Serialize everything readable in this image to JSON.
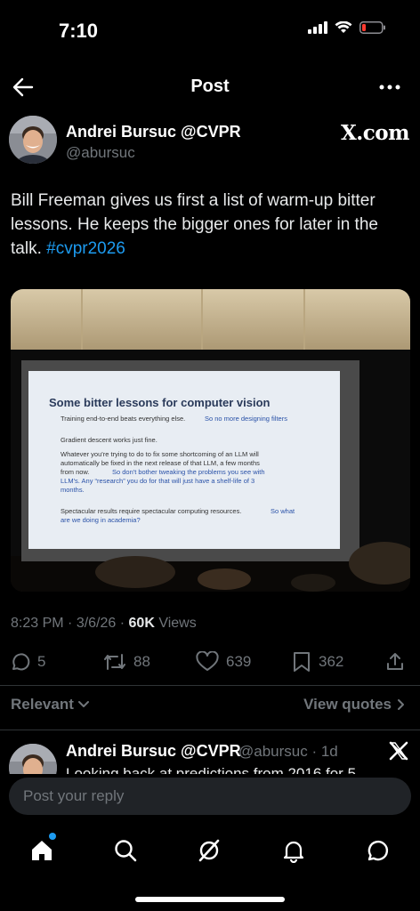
{
  "status": {
    "time": "7:10"
  },
  "nav": {
    "title": "Post"
  },
  "author": {
    "name": "Andrei Bursuc @CVPR",
    "handle": "@abursuc",
    "source_logo": "X.com"
  },
  "tweet": {
    "text": "Bill Freeman gives us first a list of warm-up bitter lessons. He keeps the bigger ones for later in the talk. ",
    "hashtag": "#cvpr2026"
  },
  "slide": {
    "title": "Some bitter lessons for computer vision",
    "p1_black": "Training end-to-end beats everything else.",
    "p1_blue": "So no more designing filters",
    "p2_black": "Gradient descent works just fine.",
    "p3_black_1": "Whatever you're trying to do to fix some shortcoming of an LLM will",
    "p3_black_2": "automatically be fixed in the next release of that LLM, a few months",
    "p3_black_3": "from now.",
    "p3_blue_1": "So don't bother tweaking the problems you see with",
    "p3_blue_2": "LLM's. Any “research” you do for that will just have a shelf-life of 3",
    "p3_blue_3": "months.",
    "p4_black": "Spectacular results require spectacular computing resources.",
    "p4_blue_1": "So what",
    "p4_blue_2": "are we doing in academia?"
  },
  "meta": {
    "time": "8:23 PM",
    "sep1": " · ",
    "date": "3/6/26",
    "sep2": " · ",
    "views_count": "60K",
    "views_label": " Views"
  },
  "actions": {
    "replies": "5",
    "reposts": "88",
    "likes": "639",
    "bookmarks": "362"
  },
  "filters": {
    "sort_label": "Relevant",
    "view_quotes": "View quotes"
  },
  "reply": {
    "name": "Andrei Bursuc @CVPR",
    "meta": "@abursuc · 1d",
    "text": "Looking back at predictions from 2016 for 5"
  },
  "composer": {
    "placeholder": "Post your reply"
  },
  "colors": {
    "accent": "#1d9bf0",
    "muted": "#71767b",
    "text": "#e7e9ea",
    "background": "#000000"
  }
}
